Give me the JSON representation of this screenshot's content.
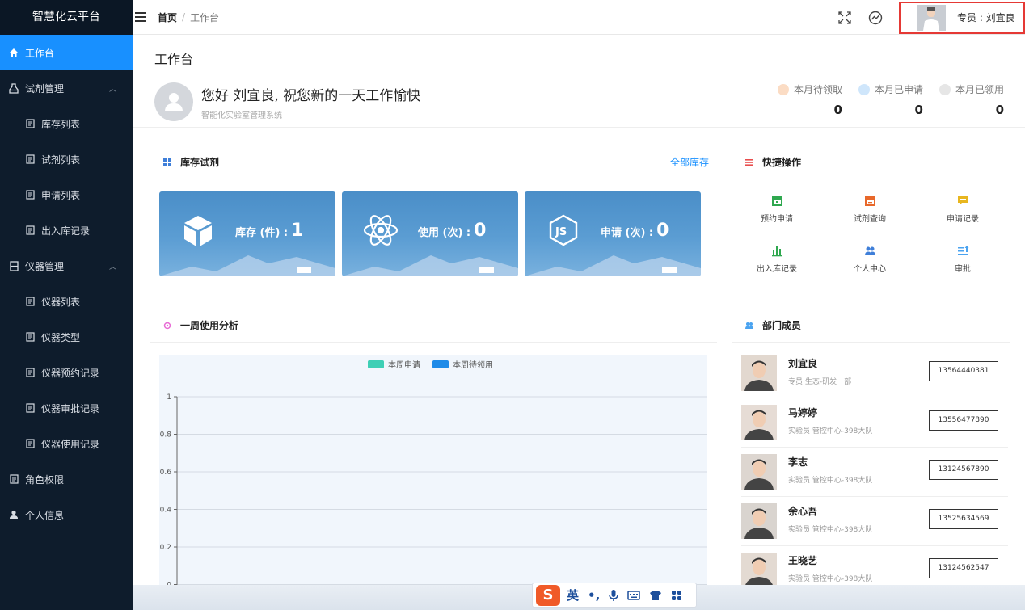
{
  "sidebar": {
    "brand": "智慧化云平台",
    "items": [
      {
        "label": "工作台",
        "icon": "home-icon"
      },
      {
        "label": "试剂管理",
        "icon": "bottle-icon"
      },
      {
        "label": "库存列表",
        "icon": "document-icon"
      },
      {
        "label": "试剂列表",
        "icon": "document-icon"
      },
      {
        "label": "申请列表",
        "icon": "document-icon"
      },
      {
        "label": "出入库记录",
        "icon": "document-icon"
      },
      {
        "label": "仪器管理",
        "icon": "instrument-icon"
      },
      {
        "label": "仪器列表",
        "icon": "document-icon"
      },
      {
        "label": "仪器类型",
        "icon": "document-icon"
      },
      {
        "label": "仪器预约记录",
        "icon": "document-icon"
      },
      {
        "label": "仪器审批记录",
        "icon": "document-icon"
      },
      {
        "label": "仪器使用记录",
        "icon": "document-icon"
      },
      {
        "label": "角色权限",
        "icon": "document-icon"
      },
      {
        "label": "个人信息",
        "icon": "user-icon"
      }
    ]
  },
  "header": {
    "breadcrumb_home": "首页",
    "breadcrumb_sep": "/",
    "breadcrumb_current": "工作台",
    "user_label": "专员 : 刘宜良"
  },
  "main": {
    "page_title": "工作台",
    "greeting": "您好 刘宜良, 祝您新的一天工作愉快",
    "system_name": "智能化实验室管理系统",
    "stats": [
      {
        "label": "本月待领取",
        "value": "0",
        "color": "#f5a25d"
      },
      {
        "label": "本月已申请",
        "value": "0",
        "color": "#4aa3f0"
      },
      {
        "label": "本月已领用",
        "value": "0",
        "color": "#bbbbbb"
      }
    ]
  },
  "stock": {
    "title": "库存试剂",
    "link": "全部库存",
    "cards": [
      {
        "label": "库存 (件) :",
        "value": "1",
        "icon": "cube-icon"
      },
      {
        "label": "使用 (次) :",
        "value": "0",
        "icon": "atom-icon"
      },
      {
        "label": "申请 (次) :",
        "value": "0",
        "icon": "nodejs-icon"
      }
    ]
  },
  "quick": {
    "title": "快捷操作",
    "items": [
      {
        "label": "预约申请",
        "icon": "calendar-icon",
        "color": "#2fa84f"
      },
      {
        "label": "试剂查询",
        "icon": "cabinet-icon",
        "color": "#e8682a"
      },
      {
        "label": "申请记录",
        "icon": "message-icon",
        "color": "#e8b61f"
      },
      {
        "label": "出入库记录",
        "icon": "bar-chart-icon",
        "color": "#2fa84f"
      },
      {
        "label": "个人中心",
        "icon": "users-icon",
        "color": "#3f7fd9"
      },
      {
        "label": "审批",
        "icon": "list-icon",
        "color": "#4aa3f0"
      }
    ]
  },
  "weekly": {
    "title": "一周使用分析"
  },
  "chart_data": {
    "type": "bar",
    "series": [
      {
        "name": "本周申请",
        "color": "#3ecfb5",
        "values": []
      },
      {
        "name": "本周待领用",
        "color": "#1f8be8",
        "values": []
      }
    ],
    "yticks": [
      "1",
      "0.8",
      "0.6",
      "0.4",
      "0.2",
      "0"
    ],
    "ylim": [
      0,
      1
    ],
    "grid": true,
    "legend": "top-center"
  },
  "members": {
    "title": "部门成员",
    "list": [
      {
        "name": "刘宜良",
        "role": "专员",
        "dept": "生态-研发一部",
        "phone": "13564440381"
      },
      {
        "name": "马婷婷",
        "role": "实验员",
        "dept": "管控中心-398大队",
        "phone": "13556477890"
      },
      {
        "name": "李志",
        "role": "实验员",
        "dept": "管控中心-398大队",
        "phone": "13124567890"
      },
      {
        "name": "余心吾",
        "role": "实验员",
        "dept": "管控中心-398大队",
        "phone": "13525634569"
      },
      {
        "name": "王晓艺",
        "role": "实验员",
        "dept": "管控中心-398大队",
        "phone": "13124562547"
      }
    ]
  },
  "ime": {
    "logo": "S",
    "mode": "英",
    "punct": "•,"
  }
}
